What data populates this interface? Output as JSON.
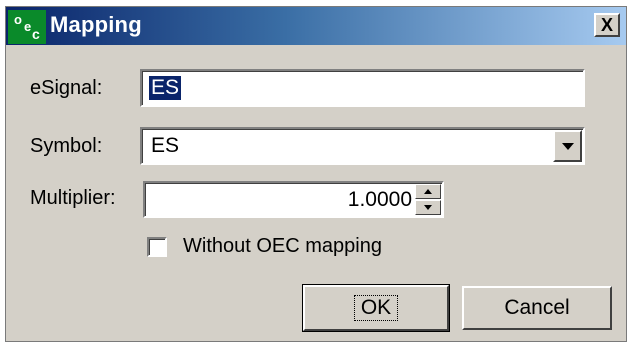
{
  "window": {
    "title": "Mapping",
    "icon": "oec-app-icon",
    "icon_letters": [
      "o",
      "e",
      "c"
    ],
    "close_label": "X"
  },
  "form": {
    "esignal_label": "eSignal:",
    "esignal_value": "ES",
    "symbol_label": "Symbol:",
    "symbol_value": "ES",
    "multiplier_label": "Multiplier:",
    "multiplier_value": "1.0000",
    "without_mapping_label": "Without OEC mapping",
    "without_mapping_checked": false
  },
  "buttons": {
    "ok_label": "OK",
    "cancel_label": "Cancel"
  },
  "colors": {
    "titlebar_start": "#0a246a",
    "titlebar_end": "#a6caf0",
    "dialog_bg": "#d4d0c8",
    "selection": "#0a246a",
    "icon_bg": "#0a8a2a"
  }
}
